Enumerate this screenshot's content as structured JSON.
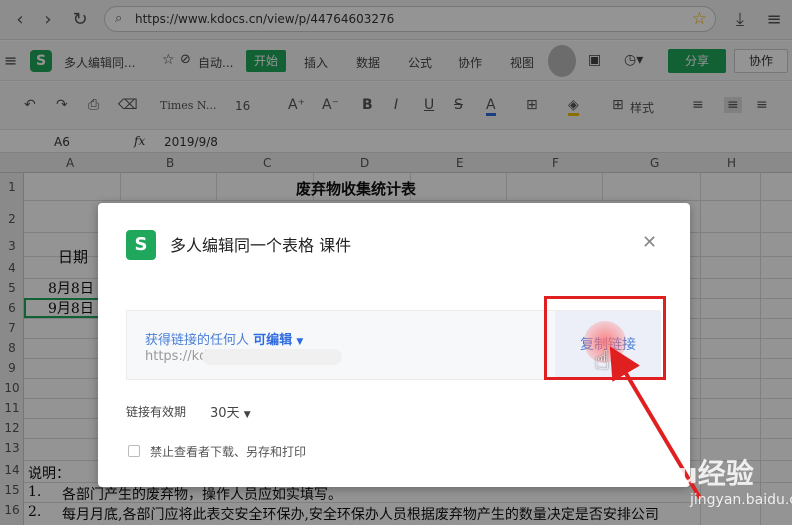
{
  "browser": {
    "url": "https://www.kdocs.cn/view/p/44764603276"
  },
  "app": {
    "doc_title": "多人编辑同...",
    "autosave": "自动...",
    "menu": [
      "开始",
      "插入",
      "数据",
      "公式",
      "协作",
      "视图"
    ],
    "share": "分享",
    "collab": "协作"
  },
  "toolbar": {
    "font": "Times N...",
    "size": "16",
    "style": "样式"
  },
  "formula": {
    "cell": "A6",
    "fx": "fx",
    "value": "2019/9/8"
  },
  "sheet": {
    "columns": [
      "A",
      "B",
      "C",
      "D",
      "E",
      "F",
      "G",
      "H"
    ],
    "rows": [
      "1",
      "2",
      "3",
      "4",
      "5",
      "6",
      "7",
      "8",
      "9",
      "10",
      "11",
      "12",
      "13",
      "14",
      "15",
      "16"
    ],
    "title": "废弃物收集统计表",
    "date_header": "日期",
    "r5": "8月8日",
    "r6": "9月8日",
    "note_label": "说明：",
    "note1_no": "1.",
    "note1": "各部门产生的废弃物，操作人员应如实填写。",
    "note2_no": "2.",
    "note2": "每月月底,各部门应将此表交安全环保办,安全环保办人员根据废弃物产生的数量决定是否安排公司"
  },
  "modal": {
    "title": "多人编辑同一个表格 课件",
    "permission_prefix": "获得链接的任何人",
    "permission": "可编辑",
    "link_prefix": "https://kd",
    "copy_button": "复制链接",
    "expiry_label": "链接有效期",
    "expiry_value": "30天",
    "checkbox_label": "禁止查看者下载、另存和打印"
  },
  "watermark": {
    "brand": "Baidu经验",
    "sub": "jingyan.baidu.com"
  },
  "colors": {
    "accent": "#1fa85b",
    "link": "#2f6be0",
    "highlight": "#e02020"
  }
}
